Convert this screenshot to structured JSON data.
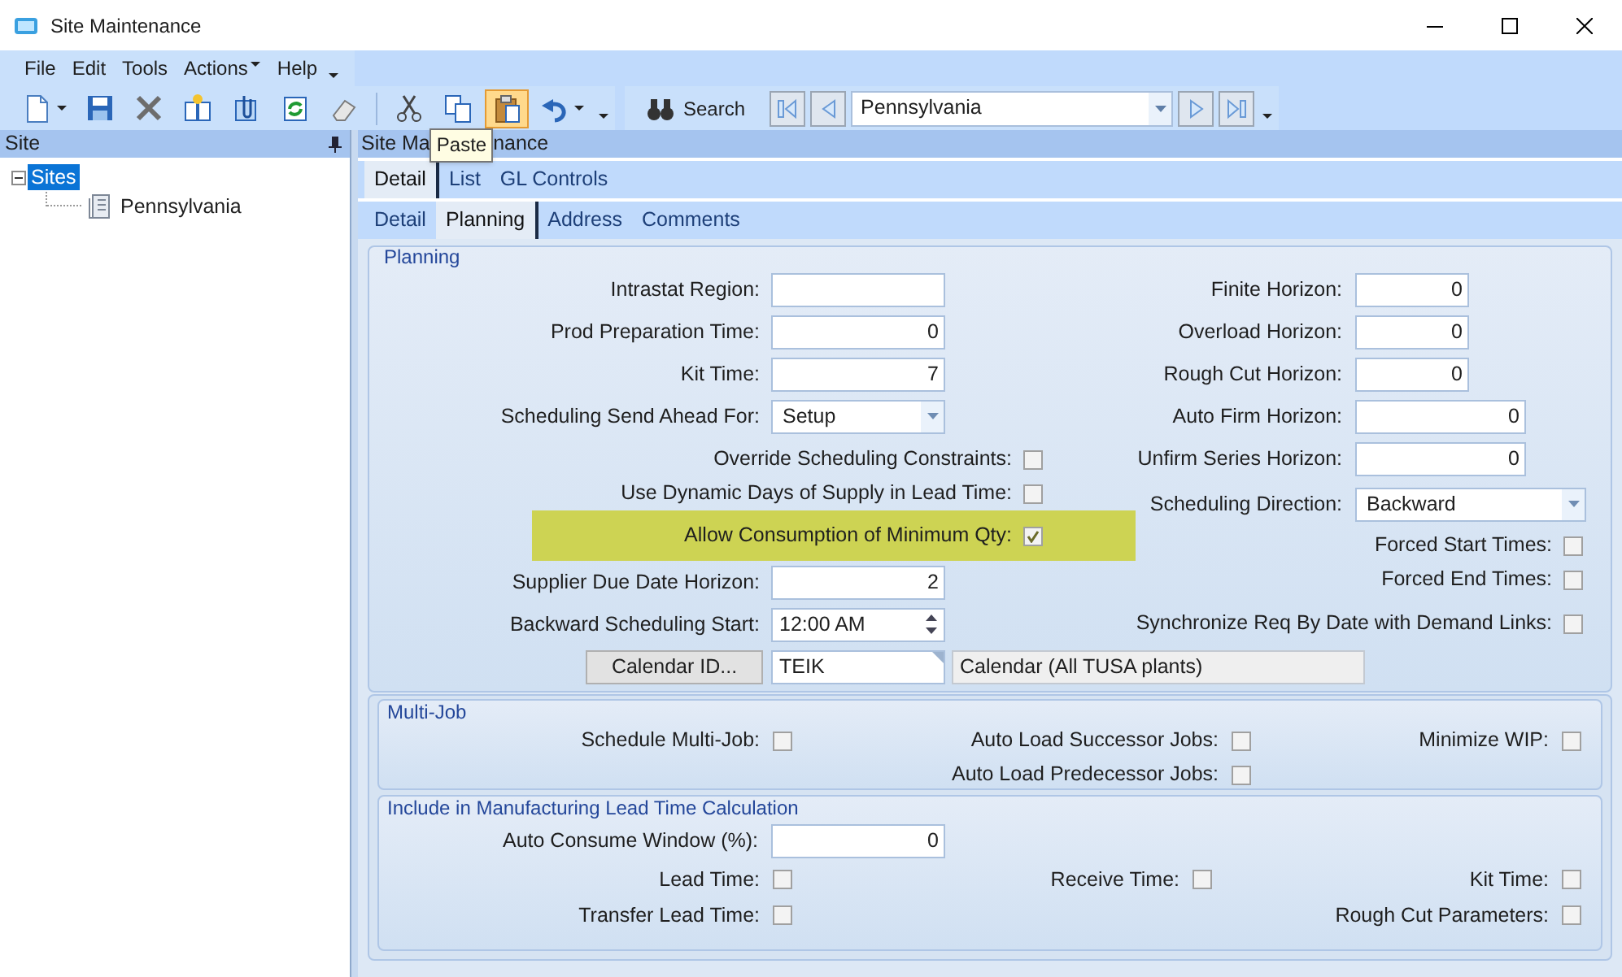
{
  "window": {
    "title": "Site Maintenance"
  },
  "menu": [
    {
      "label": "File",
      "dropdown": false
    },
    {
      "label": "Edit",
      "dropdown": false
    },
    {
      "label": "Tools",
      "dropdown": false
    },
    {
      "label": "Actions",
      "dropdown": true
    },
    {
      "label": "Help",
      "dropdown": false
    }
  ],
  "toolbar": {
    "buttons": [
      {
        "kind": "new",
        "hovered": false
      },
      {
        "kind": "save",
        "hovered": false
      },
      {
        "kind": "delete",
        "hovered": false
      },
      {
        "kind": "book",
        "hovered": false
      },
      {
        "kind": "attach",
        "hovered": false
      },
      {
        "kind": "refresh",
        "hovered": false
      },
      {
        "kind": "clear",
        "hovered": false
      },
      {
        "kind": "cut",
        "hovered": false
      },
      {
        "kind": "copy",
        "hovered": false
      },
      {
        "kind": "paste",
        "hovered": true
      },
      {
        "kind": "undo",
        "hovered": false
      }
    ],
    "tooltip": "Paste",
    "search_label": "Search",
    "record": "Pennsylvania"
  },
  "tree_pane": {
    "title": "Site",
    "tree": [
      {
        "label": "Sites",
        "selected": true,
        "expanded": true,
        "children": [
          {
            "label": "Pennsylvania",
            "selected": false
          }
        ]
      }
    ]
  },
  "main_pane": {
    "title_visible_parts": [
      "Site Ma",
      "nance"
    ]
  },
  "tabs": [
    {
      "label": "Detail",
      "selected": true
    },
    {
      "label": "List",
      "selected": false
    },
    {
      "label": "GL Controls",
      "selected": false
    }
  ],
  "subtabs": [
    {
      "label": "Detail",
      "selected": false
    },
    {
      "label": "Planning",
      "selected": true
    },
    {
      "label": "Address",
      "selected": false
    },
    {
      "label": "Comments",
      "selected": false
    }
  ],
  "planning": {
    "title": "Planning",
    "left": [
      {
        "kind": "text",
        "label": "Intrastat Region:",
        "highlighted": false
      },
      {
        "kind": "text",
        "label": "Prod Preparation Time:",
        "value": "0",
        "highlighted": false
      },
      {
        "kind": "text",
        "label": "Kit Time:",
        "value": "7",
        "highlighted": false
      },
      {
        "kind": "dropdown",
        "label": "Scheduling Send Ahead For:",
        "value": "Setup",
        "highlighted": false
      },
      {
        "kind": "checkbox",
        "label": "Override Scheduling Constraints:",
        "checked": false,
        "highlighted": false
      },
      {
        "kind": "checkbox",
        "label": "Use Dynamic Days of Supply in Lead Time:",
        "checked": false,
        "highlighted": false
      },
      {
        "kind": "checkbox",
        "label": "Allow Consumption of Minimum Qty:",
        "checked": true,
        "highlighted": true
      },
      {
        "kind": "text",
        "label": "Supplier Due Date Horizon:",
        "value": "2",
        "highlighted": false
      },
      {
        "kind": "spinner",
        "label": "Backward Scheduling Start:",
        "value": "12:00 AM",
        "highlighted": false
      }
    ],
    "calendar": {
      "button": "Calendar ID...",
      "id": "TEIK",
      "description": "Calendar (All TUSA plants)"
    },
    "right": [
      {
        "kind": "short",
        "label": "Finite Horizon:",
        "value": "0"
      },
      {
        "kind": "short",
        "label": "Overload Horizon:",
        "value": "0"
      },
      {
        "kind": "short",
        "label": "Rough Cut Horizon:",
        "value": "0"
      },
      {
        "kind": "text",
        "label": "Auto Firm Horizon:",
        "value": "0"
      },
      {
        "kind": "text",
        "label": "Unfirm Series Horizon:",
        "value": "0"
      },
      {
        "kind": "dropdown",
        "label": "Scheduling Direction:",
        "value": "Backward"
      },
      {
        "kind": "checkbox",
        "label": "Forced Start Times:",
        "checked": false
      },
      {
        "kind": "checkbox",
        "label": "Forced End Times:",
        "checked": false
      },
      {
        "kind": "checkbox",
        "label": "Synchronize Req By Date with Demand Links:",
        "checked": false
      }
    ]
  },
  "multi_job": {
    "title": "Multi-Job",
    "columns": [
      [
        {
          "label": "Schedule Multi-Job:",
          "checked": false
        }
      ],
      [
        {
          "label": "Auto Load Successor Jobs:",
          "checked": false
        },
        {
          "label": "Auto Load Predecessor Jobs:",
          "checked": false
        }
      ],
      [
        {
          "label": "Minimize WIP:",
          "checked": false
        }
      ]
    ]
  },
  "lead_time": {
    "title": "Include in Manufacturing Lead Time Calculation",
    "window_label": "Auto Consume Window (%):",
    "window_value": "0",
    "columns": [
      [
        {
          "label": "Lead Time:",
          "checked": false
        },
        {
          "label": "Transfer Lead Time:",
          "checked": false
        }
      ],
      [
        {
          "label": "Receive Time:",
          "checked": false
        }
      ],
      [
        {
          "label": "Kit Time:",
          "checked": false
        },
        {
          "label": "Rough Cut Parameters:",
          "checked": false
        }
      ]
    ]
  }
}
